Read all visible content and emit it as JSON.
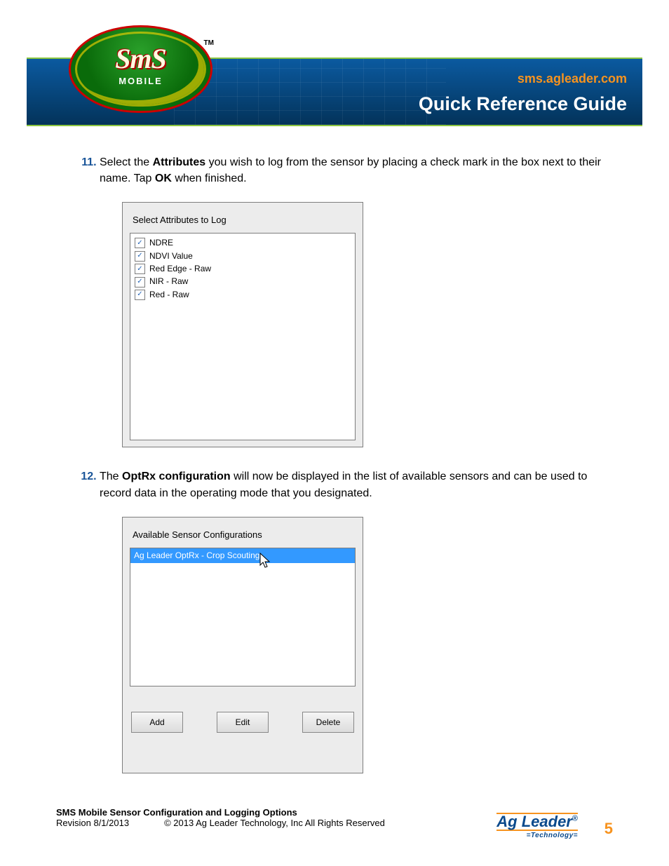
{
  "banner": {
    "url": "sms.agleader.com",
    "title": "Quick Reference Guide",
    "logo_main": "SmS",
    "logo_sub": "MOBILE",
    "logo_tm": "TM"
  },
  "steps": [
    {
      "num": "11.",
      "pre": "Select the ",
      "b1": "Attributes",
      "mid": " you wish to log from the sensor by placing a check mark in the box next to their name. Tap ",
      "b2": "OK",
      "post": " when finished."
    },
    {
      "num": "12.",
      "pre": "The ",
      "b1": "OptRx configuration",
      "mid": " will now be displayed in the list of available sensors and can be used to record data in the operating mode that you designated.",
      "b2": "",
      "post": ""
    }
  ],
  "dialog1": {
    "label": "Select Attributes to Log",
    "items": [
      "NDRE",
      "NDVI Value",
      "Red Edge - Raw",
      "NIR - Raw",
      "Red - Raw"
    ]
  },
  "dialog2": {
    "label": "Available Sensor Configurations",
    "selected": "Ag Leader OptRx - Crop Scouting",
    "buttons": {
      "add": "Add",
      "edit": "Edit",
      "del": "Delete"
    }
  },
  "footer": {
    "title": "SMS Mobile Sensor Configuration and Logging Options",
    "revision": "Revision 8/1/2013",
    "copyright": "© 2013 Ag Leader Technology, Inc All Rights Reserved",
    "logo_main": "Ag Leader",
    "logo_sub": "Technology",
    "page": "5"
  }
}
